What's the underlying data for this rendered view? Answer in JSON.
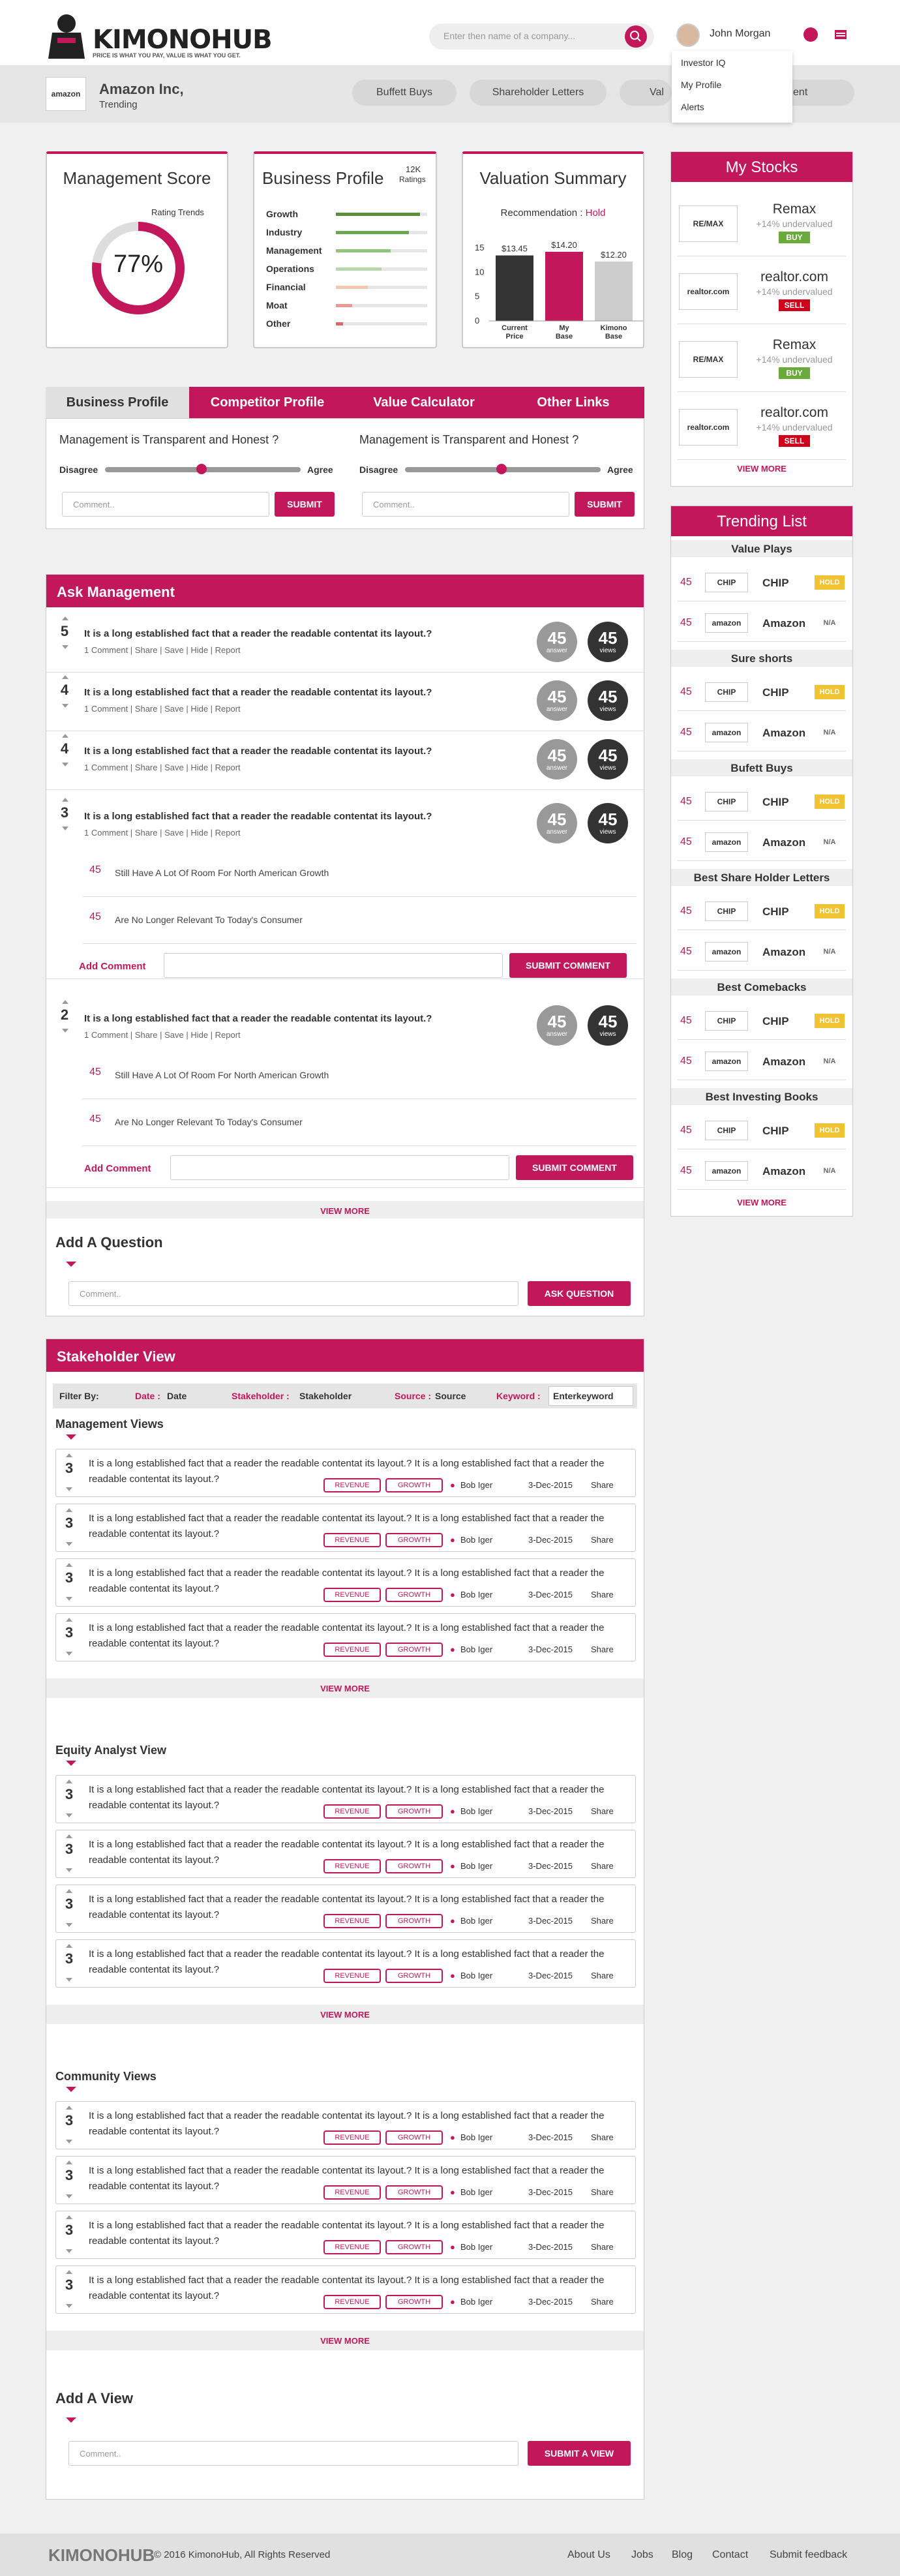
{
  "header": {
    "logo": "KIMONOHUB",
    "tagline": "PRICE IS WHAT YOU PAY, VALUE IS WHAT YOU GET.",
    "search_placeholder": "Enter  then name of a company...",
    "user_name": "John Morgan",
    "menu": [
      "Investor IQ",
      "My Profile",
      "Alerts"
    ]
  },
  "company": {
    "logo": "amazon",
    "name": "Amazon Inc,",
    "status": "Trending",
    "pills": [
      "Buffett Buys",
      "Shareholder Letters",
      "Val",
      "agement"
    ]
  },
  "management_score": {
    "title": "Management Score",
    "ratings_label": "Rating Trends",
    "percent": "77%",
    "value": 77
  },
  "business_profile": {
    "title": "Business Profile",
    "ratings_count": "12K",
    "ratings_label": "Ratings",
    "rows": [
      {
        "label": "Growth",
        "value": 0.92,
        "color": "#5b8f3a"
      },
      {
        "label": "Industry",
        "value": 0.8,
        "color": "#6aa84f"
      },
      {
        "label": "Management",
        "value": 0.6,
        "color": "#93c47d"
      },
      {
        "label": "Operations",
        "value": 0.5,
        "color": "#b6d7a8"
      },
      {
        "label": "Financial",
        "value": 0.35,
        "color": "#f4c7b0"
      },
      {
        "label": "Moat",
        "value": 0.18,
        "color": "#ea9999"
      },
      {
        "label": "Other",
        "value": 0.08,
        "color": "#e06666"
      }
    ]
  },
  "valuation": {
    "title": "Valuation Summary",
    "rec_label": "Recommendation :",
    "rec_value": "Hold"
  },
  "chart_data": {
    "type": "bar",
    "categories": [
      "Current Price",
      "My Base",
      "Kimono Base"
    ],
    "values": [
      13.45,
      14.2,
      12.2
    ],
    "labels": [
      "$13.45",
      "$14.20",
      "$12.20"
    ],
    "yticks": [
      "15",
      "10",
      "5",
      "0"
    ],
    "ylim": [
      0,
      15
    ],
    "colors": [
      "#333333",
      "#c2185b",
      "#cccccc"
    ]
  },
  "tabs": {
    "items": [
      "Business Profile",
      "Competitor Profile",
      "Value Calculator",
      "Other Links"
    ],
    "question": "Management is Transparent and Honest ?",
    "disagree": "Disagree",
    "agree": "Agree",
    "comment_ph": "Comment..",
    "submit": "SUBMIT"
  },
  "ask": {
    "title": "Ask Management",
    "question": "It is a long established fact that a reader the readable contentat its layout.?",
    "actions": "1 Comment  |  Share  |  Save  |  Hide  |  Report",
    "items": [
      {
        "votes": "5",
        "answers": "45",
        "views": "45"
      },
      {
        "votes": "4",
        "answers": "45",
        "views": "45"
      },
      {
        "votes": "4",
        "answers": "45",
        "views": "45"
      },
      {
        "votes": "3",
        "answers": "45",
        "views": "45"
      },
      {
        "votes": "2",
        "answers": "45",
        "views": "45"
      }
    ],
    "answer_label": "answer",
    "views_label": "views",
    "answers": [
      {
        "votes": "45",
        "text": "Still Have A Lot Of Room For North American Growth"
      },
      {
        "votes": "45",
        "text": "Are No Longer Relevant To Today's Consumer"
      }
    ],
    "add_comment": "Add Comment",
    "submit_comment": "SUBMIT COMMENT",
    "view_more": "VIEW MORE"
  },
  "add_question": {
    "title": "Add A Question",
    "placeholder": "Comment..",
    "button": "ASK QUESTION"
  },
  "stakeholder": {
    "title": "Stakeholder View",
    "filter_label": "Filter By:",
    "date": "Date :",
    "date_val": "Date",
    "stake": "Stakeholder :",
    "stake_val": "Stakeholder",
    "source": "Source :",
    "source_val": "Source",
    "keyword": "Keyword :",
    "keyword_val": "Enterkeyword",
    "sections": [
      "Management Views",
      "Equity Analyst View",
      "Community Views"
    ],
    "item_text": "It is a long established fact that a reader the readable contentat its layout.? It is a long established fact that a reader the readable contentat its layout.?",
    "vote": "3",
    "tag1": "REVENUE",
    "tag2": "GROWTH",
    "author": "Bob Iger",
    "date_item": "3-Dec-2015",
    "share": "Share",
    "view_more": "VIEW MORE"
  },
  "add_view": {
    "title": "Add A View",
    "placeholder": "Comment..",
    "button": "SUBMIT A VIEW"
  },
  "my_stocks": {
    "title": "My Stocks",
    "items": [
      {
        "logo": "RE/MAX",
        "name": "Remax",
        "under": "+14% undervalued",
        "badge": "BUY",
        "color": "#6aaa3a"
      },
      {
        "logo": "realtor.com",
        "name": "realtor.com",
        "under": "+14% undervalued",
        "badge": "SELL",
        "color": "#d0021b"
      },
      {
        "logo": "RE/MAX",
        "name": "Remax",
        "under": "+14% undervalued",
        "badge": "BUY",
        "color": "#6aaa3a"
      },
      {
        "logo": "realtor.com",
        "name": "realtor.com",
        "under": "+14% undervalued",
        "badge": "SELL",
        "color": "#d0021b"
      }
    ],
    "view_more": "VIEW MORE"
  },
  "trending": {
    "title": "Trending List",
    "cats": [
      "Value Plays",
      "Sure shorts",
      "Bufett Buys",
      "Best Share Holder Letters",
      "Best Comebacks",
      "Best Investing Books"
    ],
    "chip": {
      "logo": "CHIP",
      "name": "CHIP",
      "status": "HOLD"
    },
    "amazon": {
      "logo": "amazon",
      "name": "Amazon",
      "status": "N/A"
    },
    "votes": "45",
    "view_more": "VIEW MORE"
  },
  "footer": {
    "logo": "KIMONOHUB",
    "copy": "© 2016 KimonoHub, All Rights Reserved",
    "links": [
      "About Us",
      "Jobs",
      "Blog",
      "Contact",
      "Submit feedback"
    ]
  }
}
